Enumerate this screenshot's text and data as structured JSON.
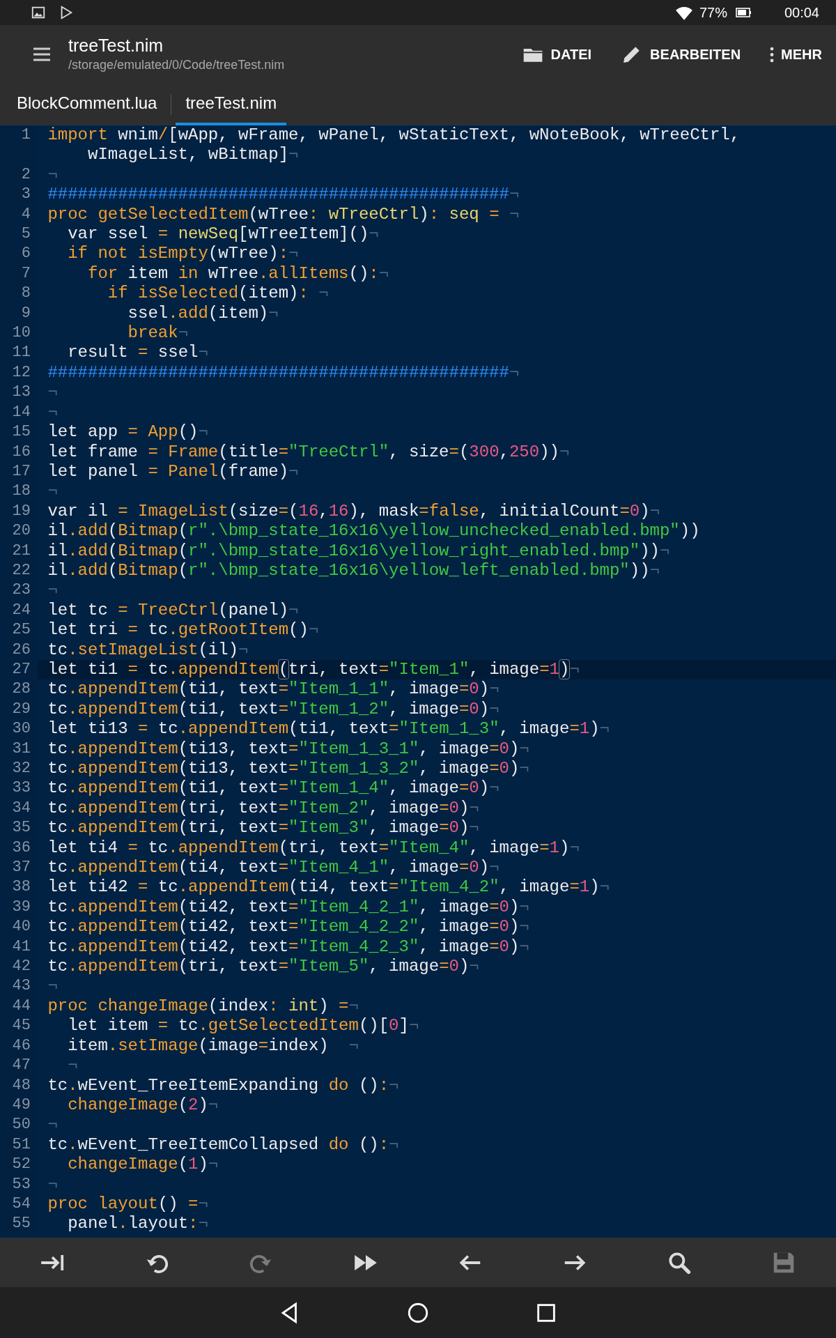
{
  "status_bar": {
    "time": "00:04",
    "battery": "77%"
  },
  "app_bar": {
    "title": "treeTest.nim",
    "path": "/storage/emulated/0/Code/treeTest.nim",
    "actions": [
      {
        "kind": "folder",
        "label": "DATEI"
      },
      {
        "kind": "pencil",
        "label": "BEARBEITEN"
      },
      {
        "kind": "more",
        "label": "MEHR"
      }
    ]
  },
  "tabs": [
    {
      "label": "BlockComment.lua",
      "selected": false
    },
    {
      "label": "treeTest.nim",
      "selected": true
    }
  ],
  "editor": {
    "lines": [
      {
        "number": "1",
        "current": false,
        "tokens": [
          {
            "kind": "kw",
            "text": "import"
          },
          {
            "kind": "p",
            "text": " wnim"
          },
          {
            "kind": "kw",
            "text": "/"
          },
          {
            "kind": "p",
            "text": "[wApp, wFrame, wPanel, wStaticText, wNoteBook, wTreeCtrl, wImageList, wBitmap]"
          },
          {
            "kind": "eol",
            "text": "¬"
          }
        ]
      },
      {
        "number": "2",
        "current": false,
        "tokens": [
          {
            "kind": "eol",
            "text": "¬"
          }
        ]
      },
      {
        "number": "3",
        "current": false,
        "tokens": [
          {
            "kind": "com",
            "text": "##############################################"
          },
          {
            "kind": "eol",
            "text": "¬"
          }
        ]
      },
      {
        "number": "4",
        "current": false,
        "tokens": [
          {
            "kind": "kw",
            "text": "proc getSelectedItem"
          },
          {
            "kind": "p",
            "text": "(wTree"
          },
          {
            "kind": "kw",
            "text": ": "
          },
          {
            "kind": "ty",
            "text": "wTreeCtrl"
          },
          {
            "kind": "p",
            "text": ")"
          },
          {
            "kind": "kw",
            "text": ": "
          },
          {
            "kind": "ty",
            "text": "seq "
          },
          {
            "kind": "kw",
            "text": "= "
          },
          {
            "kind": "eol",
            "text": "¬"
          }
        ]
      },
      {
        "number": "5",
        "current": false,
        "tokens": [
          {
            "kind": "p",
            "text": "  var ssel "
          },
          {
            "kind": "kw",
            "text": "= "
          },
          {
            "kind": "ty",
            "text": "newSeq"
          },
          {
            "kind": "p",
            "text": "[wTreeItem]()"
          },
          {
            "kind": "eol",
            "text": "¬"
          }
        ]
      },
      {
        "number": "6",
        "current": false,
        "tokens": [
          {
            "kind": "kw",
            "text": "  if not isEmpty"
          },
          {
            "kind": "p",
            "text": "(wTree)"
          },
          {
            "kind": "kw",
            "text": ":"
          },
          {
            "kind": "eol",
            "text": "¬"
          }
        ]
      },
      {
        "number": "7",
        "current": false,
        "tokens": [
          {
            "kind": "kw",
            "text": "    for"
          },
          {
            "kind": "p",
            "text": " item "
          },
          {
            "kind": "kw",
            "text": "in"
          },
          {
            "kind": "p",
            "text": " wTree"
          },
          {
            "kind": "kw",
            "text": ".allItems"
          },
          {
            "kind": "p",
            "text": "()"
          },
          {
            "kind": "kw",
            "text": ":"
          },
          {
            "kind": "eol",
            "text": "¬"
          }
        ]
      },
      {
        "number": "8",
        "current": false,
        "tokens": [
          {
            "kind": "kw",
            "text": "      if isSelected"
          },
          {
            "kind": "p",
            "text": "(item)"
          },
          {
            "kind": "kw",
            "text": ": "
          },
          {
            "kind": "eol",
            "text": "¬"
          }
        ]
      },
      {
        "number": "9",
        "current": false,
        "tokens": [
          {
            "kind": "p",
            "text": "        ssel"
          },
          {
            "kind": "kw",
            "text": ".add"
          },
          {
            "kind": "p",
            "text": "(item)"
          },
          {
            "kind": "eol",
            "text": "¬"
          }
        ]
      },
      {
        "number": "10",
        "current": false,
        "tokens": [
          {
            "kind": "kw",
            "text": "        break"
          },
          {
            "kind": "eol",
            "text": "¬"
          }
        ]
      },
      {
        "number": "11",
        "current": false,
        "tokens": [
          {
            "kind": "p",
            "text": "  result "
          },
          {
            "kind": "kw",
            "text": "="
          },
          {
            "kind": "p",
            "text": " ssel"
          },
          {
            "kind": "eol",
            "text": "¬"
          }
        ]
      },
      {
        "number": "12",
        "current": false,
        "tokens": [
          {
            "kind": "com",
            "text": "##############################################"
          },
          {
            "kind": "eol",
            "text": "¬"
          }
        ]
      },
      {
        "number": "13",
        "current": false,
        "tokens": [
          {
            "kind": "eol",
            "text": "¬"
          }
        ]
      },
      {
        "number": "14",
        "current": false,
        "tokens": [
          {
            "kind": "eol",
            "text": "¬"
          }
        ]
      },
      {
        "number": "15",
        "current": false,
        "tokens": [
          {
            "kind": "p",
            "text": "let app "
          },
          {
            "kind": "kw",
            "text": "= App"
          },
          {
            "kind": "p",
            "text": "()"
          },
          {
            "kind": "eol",
            "text": "¬"
          }
        ]
      },
      {
        "number": "16",
        "current": false,
        "tokens": [
          {
            "kind": "p",
            "text": "let frame "
          },
          {
            "kind": "kw",
            "text": "= Frame"
          },
          {
            "kind": "p",
            "text": "(title"
          },
          {
            "kind": "kw",
            "text": "="
          },
          {
            "kind": "str",
            "text": "\"TreeCtrl\""
          },
          {
            "kind": "p",
            "text": ", size"
          },
          {
            "kind": "kw",
            "text": "="
          },
          {
            "kind": "p",
            "text": "("
          },
          {
            "kind": "num",
            "text": "300"
          },
          {
            "kind": "p",
            "text": ","
          },
          {
            "kind": "num",
            "text": "250"
          },
          {
            "kind": "p",
            "text": "))"
          },
          {
            "kind": "eol",
            "text": "¬"
          }
        ]
      },
      {
        "number": "17",
        "current": false,
        "tokens": [
          {
            "kind": "p",
            "text": "let panel "
          },
          {
            "kind": "kw",
            "text": "= Panel"
          },
          {
            "kind": "p",
            "text": "(frame)"
          },
          {
            "kind": "eol",
            "text": "¬"
          }
        ]
      },
      {
        "number": "18",
        "current": false,
        "tokens": [
          {
            "kind": "eol",
            "text": "¬"
          }
        ]
      },
      {
        "number": "19",
        "current": false,
        "tokens": [
          {
            "kind": "p",
            "text": "var il "
          },
          {
            "kind": "kw",
            "text": "= ImageList"
          },
          {
            "kind": "p",
            "text": "(size"
          },
          {
            "kind": "kw",
            "text": "="
          },
          {
            "kind": "p",
            "text": "("
          },
          {
            "kind": "num",
            "text": "16"
          },
          {
            "kind": "p",
            "text": ","
          },
          {
            "kind": "num",
            "text": "16"
          },
          {
            "kind": "p",
            "text": "), mask"
          },
          {
            "kind": "kw",
            "text": "=false"
          },
          {
            "kind": "p",
            "text": ", initialCount"
          },
          {
            "kind": "kw",
            "text": "="
          },
          {
            "kind": "num",
            "text": "0"
          },
          {
            "kind": "p",
            "text": ")"
          },
          {
            "kind": "eol",
            "text": "¬"
          }
        ]
      },
      {
        "number": "20",
        "current": false,
        "tokens": [
          {
            "kind": "p",
            "text": "il"
          },
          {
            "kind": "kw",
            "text": ".add"
          },
          {
            "kind": "p",
            "text": "("
          },
          {
            "kind": "kw",
            "text": "Bitmap"
          },
          {
            "kind": "p",
            "text": "("
          },
          {
            "kind": "str",
            "text": "r\".\\bmp_state_16x16\\yellow_unchecked_enabled.bmp\""
          },
          {
            "kind": "p",
            "text": "))"
          }
        ]
      },
      {
        "number": "21",
        "current": false,
        "tokens": [
          {
            "kind": "p",
            "text": "il"
          },
          {
            "kind": "kw",
            "text": ".add"
          },
          {
            "kind": "p",
            "text": "("
          },
          {
            "kind": "kw",
            "text": "Bitmap"
          },
          {
            "kind": "p",
            "text": "("
          },
          {
            "kind": "str",
            "text": "r\".\\bmp_state_16x16\\yellow_right_enabled.bmp\""
          },
          {
            "kind": "p",
            "text": "))"
          },
          {
            "kind": "eol",
            "text": "¬"
          }
        ]
      },
      {
        "number": "22",
        "current": false,
        "tokens": [
          {
            "kind": "p",
            "text": "il"
          },
          {
            "kind": "kw",
            "text": ".add"
          },
          {
            "kind": "p",
            "text": "("
          },
          {
            "kind": "kw",
            "text": "Bitmap"
          },
          {
            "kind": "p",
            "text": "("
          },
          {
            "kind": "str",
            "text": "r\".\\bmp_state_16x16\\yellow_left_enabled.bmp\""
          },
          {
            "kind": "p",
            "text": "))"
          },
          {
            "kind": "eol",
            "text": "¬"
          }
        ]
      },
      {
        "number": "23",
        "current": false,
        "tokens": [
          {
            "kind": "eol",
            "text": "¬"
          }
        ]
      },
      {
        "number": "24",
        "current": false,
        "tokens": [
          {
            "kind": "p",
            "text": "let tc "
          },
          {
            "kind": "kw",
            "text": "= TreeCtrl"
          },
          {
            "kind": "p",
            "text": "(panel)"
          },
          {
            "kind": "eol",
            "text": "¬"
          }
        ]
      },
      {
        "number": "25",
        "current": false,
        "tokens": [
          {
            "kind": "p",
            "text": "let tri "
          },
          {
            "kind": "kw",
            "text": "="
          },
          {
            "kind": "p",
            "text": " tc"
          },
          {
            "kind": "kw",
            "text": ".getRootItem"
          },
          {
            "kind": "p",
            "text": "()"
          },
          {
            "kind": "eol",
            "text": "¬"
          }
        ]
      },
      {
        "number": "26",
        "current": false,
        "tokens": [
          {
            "kind": "p",
            "text": "tc"
          },
          {
            "kind": "kw",
            "text": ".setImageList"
          },
          {
            "kind": "p",
            "text": "(il)"
          },
          {
            "kind": "eol",
            "text": "¬"
          }
        ]
      },
      {
        "number": "27",
        "current": true,
        "tokens": [
          {
            "kind": "p",
            "text": "let ti1 "
          },
          {
            "kind": "kw",
            "text": "="
          },
          {
            "kind": "p",
            "text": " tc"
          },
          {
            "kind": "kw",
            "text": ".appendItem"
          },
          {
            "kind": "match",
            "text": "("
          },
          {
            "kind": "p",
            "text": "tri, text"
          },
          {
            "kind": "kw",
            "text": "="
          },
          {
            "kind": "str",
            "text": "\"Item_1\""
          },
          {
            "kind": "p",
            "text": ", image"
          },
          {
            "kind": "kw",
            "text": "="
          },
          {
            "kind": "num",
            "text": "1"
          },
          {
            "kind": "match",
            "text": ")"
          },
          {
            "kind": "eol",
            "text": "¬"
          }
        ]
      },
      {
        "number": "28",
        "current": false,
        "tokens": [
          {
            "kind": "p",
            "text": "tc"
          },
          {
            "kind": "kw",
            "text": ".appendItem"
          },
          {
            "kind": "p",
            "text": "(ti1, text"
          },
          {
            "kind": "kw",
            "text": "="
          },
          {
            "kind": "str",
            "text": "\"Item_1_1\""
          },
          {
            "kind": "p",
            "text": ", image"
          },
          {
            "kind": "kw",
            "text": "="
          },
          {
            "kind": "num",
            "text": "0"
          },
          {
            "kind": "p",
            "text": ")"
          },
          {
            "kind": "eol",
            "text": "¬"
          }
        ]
      },
      {
        "number": "29",
        "current": false,
        "tokens": [
          {
            "kind": "p",
            "text": "tc"
          },
          {
            "kind": "kw",
            "text": ".appendItem"
          },
          {
            "kind": "p",
            "text": "(ti1, text"
          },
          {
            "kind": "kw",
            "text": "="
          },
          {
            "kind": "str",
            "text": "\"Item_1_2\""
          },
          {
            "kind": "p",
            "text": ", image"
          },
          {
            "kind": "kw",
            "text": "="
          },
          {
            "kind": "num",
            "text": "0"
          },
          {
            "kind": "p",
            "text": ")"
          },
          {
            "kind": "eol",
            "text": "¬"
          }
        ]
      },
      {
        "number": "30",
        "current": false,
        "tokens": [
          {
            "kind": "p",
            "text": "let ti13 "
          },
          {
            "kind": "kw",
            "text": "="
          },
          {
            "kind": "p",
            "text": " tc"
          },
          {
            "kind": "kw",
            "text": ".appendItem"
          },
          {
            "kind": "p",
            "text": "(ti1, text"
          },
          {
            "kind": "kw",
            "text": "="
          },
          {
            "kind": "str",
            "text": "\"Item_1_3\""
          },
          {
            "kind": "p",
            "text": ", image"
          },
          {
            "kind": "kw",
            "text": "="
          },
          {
            "kind": "num",
            "text": "1"
          },
          {
            "kind": "p",
            "text": ")"
          },
          {
            "kind": "eol",
            "text": "¬"
          }
        ]
      },
      {
        "number": "31",
        "current": false,
        "tokens": [
          {
            "kind": "p",
            "text": "tc"
          },
          {
            "kind": "kw",
            "text": ".appendItem"
          },
          {
            "kind": "p",
            "text": "(ti13, text"
          },
          {
            "kind": "kw",
            "text": "="
          },
          {
            "kind": "str",
            "text": "\"Item_1_3_1\""
          },
          {
            "kind": "p",
            "text": ", image"
          },
          {
            "kind": "kw",
            "text": "="
          },
          {
            "kind": "num",
            "text": "0"
          },
          {
            "kind": "p",
            "text": ")"
          },
          {
            "kind": "eol",
            "text": "¬"
          }
        ]
      },
      {
        "number": "32",
        "current": false,
        "tokens": [
          {
            "kind": "p",
            "text": "tc"
          },
          {
            "kind": "kw",
            "text": ".appendItem"
          },
          {
            "kind": "p",
            "text": "(ti13, text"
          },
          {
            "kind": "kw",
            "text": "="
          },
          {
            "kind": "str",
            "text": "\"Item_1_3_2\""
          },
          {
            "kind": "p",
            "text": ", image"
          },
          {
            "kind": "kw",
            "text": "="
          },
          {
            "kind": "num",
            "text": "0"
          },
          {
            "kind": "p",
            "text": ")"
          },
          {
            "kind": "eol",
            "text": "¬"
          }
        ]
      },
      {
        "number": "33",
        "current": false,
        "tokens": [
          {
            "kind": "p",
            "text": "tc"
          },
          {
            "kind": "kw",
            "text": ".appendItem"
          },
          {
            "kind": "p",
            "text": "(ti1, text"
          },
          {
            "kind": "kw",
            "text": "="
          },
          {
            "kind": "str",
            "text": "\"Item_1_4\""
          },
          {
            "kind": "p",
            "text": ", image"
          },
          {
            "kind": "kw",
            "text": "="
          },
          {
            "kind": "num",
            "text": "0"
          },
          {
            "kind": "p",
            "text": ")"
          },
          {
            "kind": "eol",
            "text": "¬"
          }
        ]
      },
      {
        "number": "34",
        "current": false,
        "tokens": [
          {
            "kind": "p",
            "text": "tc"
          },
          {
            "kind": "kw",
            "text": ".appendItem"
          },
          {
            "kind": "p",
            "text": "(tri, text"
          },
          {
            "kind": "kw",
            "text": "="
          },
          {
            "kind": "str",
            "text": "\"Item_2\""
          },
          {
            "kind": "p",
            "text": ", image"
          },
          {
            "kind": "kw",
            "text": "="
          },
          {
            "kind": "num",
            "text": "0"
          },
          {
            "kind": "p",
            "text": ")"
          },
          {
            "kind": "eol",
            "text": "¬"
          }
        ]
      },
      {
        "number": "35",
        "current": false,
        "tokens": [
          {
            "kind": "p",
            "text": "tc"
          },
          {
            "kind": "kw",
            "text": ".appendItem"
          },
          {
            "kind": "p",
            "text": "(tri, text"
          },
          {
            "kind": "kw",
            "text": "="
          },
          {
            "kind": "str",
            "text": "\"Item_3\""
          },
          {
            "kind": "p",
            "text": ", image"
          },
          {
            "kind": "kw",
            "text": "="
          },
          {
            "kind": "num",
            "text": "0"
          },
          {
            "kind": "p",
            "text": ")"
          },
          {
            "kind": "eol",
            "text": "¬"
          }
        ]
      },
      {
        "number": "36",
        "current": false,
        "tokens": [
          {
            "kind": "p",
            "text": "let ti4 "
          },
          {
            "kind": "kw",
            "text": "="
          },
          {
            "kind": "p",
            "text": " tc"
          },
          {
            "kind": "kw",
            "text": ".appendItem"
          },
          {
            "kind": "p",
            "text": "(tri, text"
          },
          {
            "kind": "kw",
            "text": "="
          },
          {
            "kind": "str",
            "text": "\"Item_4\""
          },
          {
            "kind": "p",
            "text": ", image"
          },
          {
            "kind": "kw",
            "text": "="
          },
          {
            "kind": "num",
            "text": "1"
          },
          {
            "kind": "p",
            "text": ")"
          },
          {
            "kind": "eol",
            "text": "¬"
          }
        ]
      },
      {
        "number": "37",
        "current": false,
        "tokens": [
          {
            "kind": "p",
            "text": "tc"
          },
          {
            "kind": "kw",
            "text": ".appendItem"
          },
          {
            "kind": "p",
            "text": "(ti4, text"
          },
          {
            "kind": "kw",
            "text": "="
          },
          {
            "kind": "str",
            "text": "\"Item_4_1\""
          },
          {
            "kind": "p",
            "text": ", image"
          },
          {
            "kind": "kw",
            "text": "="
          },
          {
            "kind": "num",
            "text": "0"
          },
          {
            "kind": "p",
            "text": ")"
          },
          {
            "kind": "eol",
            "text": "¬"
          }
        ]
      },
      {
        "number": "38",
        "current": false,
        "tokens": [
          {
            "kind": "p",
            "text": "let ti42 "
          },
          {
            "kind": "kw",
            "text": "="
          },
          {
            "kind": "p",
            "text": " tc"
          },
          {
            "kind": "kw",
            "text": ".appendItem"
          },
          {
            "kind": "p",
            "text": "(ti4, text"
          },
          {
            "kind": "kw",
            "text": "="
          },
          {
            "kind": "str",
            "text": "\"Item_4_2\""
          },
          {
            "kind": "p",
            "text": ", image"
          },
          {
            "kind": "kw",
            "text": "="
          },
          {
            "kind": "num",
            "text": "1"
          },
          {
            "kind": "p",
            "text": ")"
          },
          {
            "kind": "eol",
            "text": "¬"
          }
        ]
      },
      {
        "number": "39",
        "current": false,
        "tokens": [
          {
            "kind": "p",
            "text": "tc"
          },
          {
            "kind": "kw",
            "text": ".appendItem"
          },
          {
            "kind": "p",
            "text": "(ti42, text"
          },
          {
            "kind": "kw",
            "text": "="
          },
          {
            "kind": "str",
            "text": "\"Item_4_2_1\""
          },
          {
            "kind": "p",
            "text": ", image"
          },
          {
            "kind": "kw",
            "text": "="
          },
          {
            "kind": "num",
            "text": "0"
          },
          {
            "kind": "p",
            "text": ")"
          },
          {
            "kind": "eol",
            "text": "¬"
          }
        ]
      },
      {
        "number": "40",
        "current": false,
        "tokens": [
          {
            "kind": "p",
            "text": "tc"
          },
          {
            "kind": "kw",
            "text": ".appendItem"
          },
          {
            "kind": "p",
            "text": "(ti42, text"
          },
          {
            "kind": "kw",
            "text": "="
          },
          {
            "kind": "str",
            "text": "\"Item_4_2_2\""
          },
          {
            "kind": "p",
            "text": ", image"
          },
          {
            "kind": "kw",
            "text": "="
          },
          {
            "kind": "num",
            "text": "0"
          },
          {
            "kind": "p",
            "text": ")"
          },
          {
            "kind": "eol",
            "text": "¬"
          }
        ]
      },
      {
        "number": "41",
        "current": false,
        "tokens": [
          {
            "kind": "p",
            "text": "tc"
          },
          {
            "kind": "kw",
            "text": ".appendItem"
          },
          {
            "kind": "p",
            "text": "(ti42, text"
          },
          {
            "kind": "kw",
            "text": "="
          },
          {
            "kind": "str",
            "text": "\"Item_4_2_3\""
          },
          {
            "kind": "p",
            "text": ", image"
          },
          {
            "kind": "kw",
            "text": "="
          },
          {
            "kind": "num",
            "text": "0"
          },
          {
            "kind": "p",
            "text": ")"
          },
          {
            "kind": "eol",
            "text": "¬"
          }
        ]
      },
      {
        "number": "42",
        "current": false,
        "tokens": [
          {
            "kind": "p",
            "text": "tc"
          },
          {
            "kind": "kw",
            "text": ".appendItem"
          },
          {
            "kind": "p",
            "text": "(tri, text"
          },
          {
            "kind": "kw",
            "text": "="
          },
          {
            "kind": "str",
            "text": "\"Item_5\""
          },
          {
            "kind": "p",
            "text": ", image"
          },
          {
            "kind": "kw",
            "text": "="
          },
          {
            "kind": "num",
            "text": "0"
          },
          {
            "kind": "p",
            "text": ")"
          },
          {
            "kind": "eol",
            "text": "¬"
          }
        ]
      },
      {
        "number": "43",
        "current": false,
        "tokens": [
          {
            "kind": "eol",
            "text": "¬"
          }
        ]
      },
      {
        "number": "44",
        "current": false,
        "tokens": [
          {
            "kind": "kw",
            "text": "proc changeImage"
          },
          {
            "kind": "p",
            "text": "(index"
          },
          {
            "kind": "kw",
            "text": ": "
          },
          {
            "kind": "ty",
            "text": "int"
          },
          {
            "kind": "p",
            "text": ") "
          },
          {
            "kind": "kw",
            "text": "="
          },
          {
            "kind": "eol",
            "text": "¬"
          }
        ]
      },
      {
        "number": "45",
        "current": false,
        "tokens": [
          {
            "kind": "p",
            "text": "  let item "
          },
          {
            "kind": "kw",
            "text": "="
          },
          {
            "kind": "p",
            "text": " tc"
          },
          {
            "kind": "kw",
            "text": ".getSelectedItem"
          },
          {
            "kind": "p",
            "text": "()["
          },
          {
            "kind": "num",
            "text": "0"
          },
          {
            "kind": "p",
            "text": "]"
          },
          {
            "kind": "eol",
            "text": "¬"
          }
        ]
      },
      {
        "number": "46",
        "current": false,
        "tokens": [
          {
            "kind": "p",
            "text": "  item"
          },
          {
            "kind": "kw",
            "text": ".setImage"
          },
          {
            "kind": "p",
            "text": "(image"
          },
          {
            "kind": "kw",
            "text": "="
          },
          {
            "kind": "p",
            "text": "index)"
          },
          {
            "kind": "eol",
            "text": "  ¬"
          }
        ]
      },
      {
        "number": "47",
        "current": false,
        "tokens": [
          {
            "kind": "eol",
            "text": "  ¬"
          }
        ]
      },
      {
        "number": "48",
        "current": false,
        "tokens": [
          {
            "kind": "p",
            "text": "tc"
          },
          {
            "kind": "kw",
            "text": "."
          },
          {
            "kind": "p",
            "text": "wEvent_TreeItemExpanding "
          },
          {
            "kind": "kw",
            "text": "do"
          },
          {
            "kind": "p",
            "text": " ()"
          },
          {
            "kind": "kw",
            "text": ":"
          },
          {
            "kind": "eol",
            "text": "¬"
          }
        ]
      },
      {
        "number": "49",
        "current": false,
        "tokens": [
          {
            "kind": "kw",
            "text": "  changeImage"
          },
          {
            "kind": "p",
            "text": "("
          },
          {
            "kind": "num",
            "text": "2"
          },
          {
            "kind": "p",
            "text": ")"
          },
          {
            "kind": "eol",
            "text": "¬"
          }
        ]
      },
      {
        "number": "50",
        "current": false,
        "tokens": [
          {
            "kind": "eol",
            "text": "¬"
          }
        ]
      },
      {
        "number": "51",
        "current": false,
        "tokens": [
          {
            "kind": "p",
            "text": "tc"
          },
          {
            "kind": "kw",
            "text": "."
          },
          {
            "kind": "p",
            "text": "wEvent_TreeItemCollapsed "
          },
          {
            "kind": "kw",
            "text": "do"
          },
          {
            "kind": "p",
            "text": " ()"
          },
          {
            "kind": "kw",
            "text": ":"
          },
          {
            "kind": "eol",
            "text": "¬"
          }
        ]
      },
      {
        "number": "52",
        "current": false,
        "tokens": [
          {
            "kind": "kw",
            "text": "  changeImage"
          },
          {
            "kind": "p",
            "text": "("
          },
          {
            "kind": "num",
            "text": "1"
          },
          {
            "kind": "p",
            "text": ")"
          },
          {
            "kind": "eol",
            "text": "¬"
          }
        ]
      },
      {
        "number": "53",
        "current": false,
        "tokens": [
          {
            "kind": "eol",
            "text": "¬"
          }
        ]
      },
      {
        "number": "54",
        "current": false,
        "tokens": [
          {
            "kind": "kw",
            "text": "proc layout"
          },
          {
            "kind": "p",
            "text": "() "
          },
          {
            "kind": "kw",
            "text": "="
          },
          {
            "kind": "eol",
            "text": "¬"
          }
        ]
      },
      {
        "number": "55",
        "current": false,
        "tokens": [
          {
            "kind": "p",
            "text": "  panel"
          },
          {
            "kind": "kw",
            "text": "."
          },
          {
            "kind": "p",
            "text": "layout"
          },
          {
            "kind": "kw",
            "text": ":"
          },
          {
            "kind": "eol",
            "text": "¬"
          }
        ]
      }
    ]
  },
  "toolbar": [
    {
      "kind": "indent",
      "disabled": false
    },
    {
      "kind": "undo",
      "disabled": false
    },
    {
      "kind": "redo",
      "disabled": true
    },
    {
      "kind": "skip",
      "disabled": false
    },
    {
      "kind": "back",
      "disabled": false
    },
    {
      "kind": "forward",
      "disabled": false
    },
    {
      "kind": "search",
      "disabled": false
    },
    {
      "kind": "save",
      "disabled": true
    }
  ]
}
